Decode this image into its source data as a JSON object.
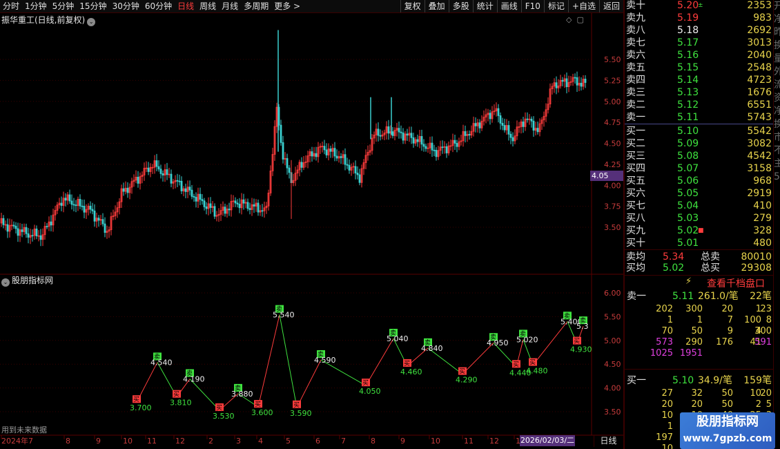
{
  "toolbar": {
    "periods": [
      "分时",
      "1分钟",
      "5分钟",
      "15分钟",
      "30分钟",
      "60分钟",
      "日线",
      "周线",
      "月线",
      "多周期",
      "更多 >"
    ],
    "active_period": "日线",
    "actions": [
      "复权",
      "叠加",
      "多股",
      "统计",
      "画线",
      "F10",
      "标记",
      "+自选",
      "返回"
    ]
  },
  "price_panel": {
    "title": "振华重工(日线,前复权)",
    "y_ticks": [
      "5.50",
      "5.25",
      "5.00",
      "4.75",
      "4.50",
      "4.25",
      "4.00",
      "3.75",
      "3.50"
    ],
    "current_price_tag": "4.05"
  },
  "indicator_panel": {
    "title": "股朋指标网",
    "y_ticks": [
      "6.00",
      "5.50",
      "5.00",
      "4.50",
      "4.00",
      "3.50"
    ],
    "footer_note": "用到未来数据",
    "buy_label": "买",
    "sell_label": "卖",
    "points": [
      {
        "type": "buy",
        "value": "3.700",
        "i": 0
      },
      {
        "type": "sell",
        "value": "4.540",
        "i": 1
      },
      {
        "type": "buy",
        "value": "3.810",
        "i": 2
      },
      {
        "type": "sell",
        "value": "4.190",
        "i": 3
      },
      {
        "type": "buy",
        "value": "3.530",
        "i": 4
      },
      {
        "type": "sell",
        "value": "3.880",
        "i": 5
      },
      {
        "type": "buy",
        "value": "3.600",
        "i": 6
      },
      {
        "type": "sell",
        "value": "5.540",
        "i": 7
      },
      {
        "type": "buy",
        "value": "3.590",
        "i": 8
      },
      {
        "type": "sell",
        "value": "4.590",
        "i": 9
      },
      {
        "type": "buy",
        "value": "4.050",
        "i": 10
      },
      {
        "type": "sell",
        "value": "5.040",
        "i": 11
      },
      {
        "type": "buy",
        "value": "4.460",
        "i": 12
      },
      {
        "type": "sell",
        "value": "4.840",
        "i": 13
      },
      {
        "type": "buy",
        "value": "4.290",
        "i": 14
      },
      {
        "type": "sell",
        "value": "4.950",
        "i": 15
      },
      {
        "type": "buy",
        "value": "4.440",
        "i": 16
      },
      {
        "type": "sell",
        "value": "5.020",
        "i": 17
      },
      {
        "type": "buy",
        "value": "4.480",
        "i": 18
      },
      {
        "type": "sell",
        "value": "5.400",
        "i": 19
      },
      {
        "type": "buy",
        "value": "4.930",
        "i": 20
      },
      {
        "type": "sell",
        "value": "5.3",
        "i": 21
      }
    ]
  },
  "time_axis": {
    "labels": [
      "2024年7",
      "8",
      "9",
      "10",
      "11",
      "12",
      "2",
      "3",
      "4",
      "5",
      "6",
      "7",
      "8",
      "9",
      "10",
      "11",
      "12",
      "1"
    ],
    "date_label": "2026/02/03/二",
    "period_button": "日线"
  },
  "order_book": {
    "asks": [
      {
        "label": "卖十",
        "price": "5.20",
        "vol": "2353",
        "pc": "r",
        "mark": "±",
        "mc": "g"
      },
      {
        "label": "卖九",
        "price": "5.19",
        "vol": "983",
        "pc": "r"
      },
      {
        "label": "卖八",
        "price": "5.18",
        "vol": "2692",
        "pc": "w"
      },
      {
        "label": "卖七",
        "price": "5.17",
        "vol": "3013",
        "pc": "g"
      },
      {
        "label": "卖六",
        "price": "5.16",
        "vol": "2040",
        "pc": "g"
      },
      {
        "label": "卖五",
        "price": "5.15",
        "vol": "2548",
        "pc": "g"
      },
      {
        "label": "卖四",
        "price": "5.14",
        "vol": "4723",
        "pc": "g"
      },
      {
        "label": "卖三",
        "price": "5.13",
        "vol": "1676",
        "pc": "g"
      },
      {
        "label": "卖二",
        "price": "5.12",
        "vol": "6551",
        "pc": "g"
      },
      {
        "label": "卖一",
        "price": "5.11",
        "vol": "5743",
        "pc": "g"
      }
    ],
    "bids": [
      {
        "label": "买一",
        "price": "5.10",
        "vol": "5542",
        "pc": "g"
      },
      {
        "label": "买二",
        "price": "5.09",
        "vol": "3082",
        "pc": "g"
      },
      {
        "label": "买三",
        "price": "5.08",
        "vol": "4542",
        "pc": "g"
      },
      {
        "label": "买四",
        "price": "5.07",
        "vol": "3158",
        "pc": "g"
      },
      {
        "label": "买五",
        "price": "5.06",
        "vol": "968",
        "pc": "g"
      },
      {
        "label": "买六",
        "price": "5.05",
        "vol": "2919",
        "pc": "g"
      },
      {
        "label": "买七",
        "price": "5.04",
        "vol": "410",
        "pc": "g"
      },
      {
        "label": "买八",
        "price": "5.03",
        "vol": "279",
        "pc": "g"
      },
      {
        "label": "买九",
        "price": "5.02",
        "vol": "328",
        "pc": "g",
        "mark": "■",
        "mc": "r"
      },
      {
        "label": "买十",
        "price": "5.01",
        "vol": "480",
        "pc": "g"
      }
    ],
    "avg_sell": {
      "label": "卖均",
      "price": "5.34",
      "total_label": "总卖",
      "total": "80010"
    },
    "avg_buy": {
      "label": "买均",
      "price": "5.02",
      "total_label": "总买",
      "total": "29308"
    },
    "depth_button": "查看千档盘口"
  },
  "queue": {
    "ask1": {
      "label": "卖一",
      "price": "5.11",
      "vol": "261.0/笔",
      "count": "22笔"
    },
    "ask_rows": [
      [
        "202",
        "300",
        "20",
        "1",
        "23"
      ],
      [
        "1",
        "1",
        "7",
        "100",
        "8"
      ],
      [
        "70",
        "50",
        "9",
        "4",
        "300"
      ],
      [
        "573",
        "290",
        "176",
        "41",
        "591"
      ],
      [
        "1025",
        "1951",
        "",
        "",
        ""
      ]
    ],
    "bid1": {
      "label": "买一",
      "price": "5.10",
      "vol": "34.9/笔",
      "count": "159笔"
    },
    "bid_rows": [
      [
        "27",
        "32",
        "50",
        "10",
        "20"
      ],
      [
        "20",
        "20",
        "50",
        "2",
        "5"
      ],
      [
        "10",
        "10",
        "40",
        "25",
        "3"
      ],
      [
        "1",
        "50",
        "",
        "",
        ""
      ],
      [
        "197",
        "",
        "",
        "",
        ""
      ],
      [
        "10",
        "20",
        "",
        "",
        ""
      ]
    ]
  },
  "side_edge": [
    "开",
    "净",
    "昨",
    "换",
    "量",
    "外",
    "流",
    "资",
    "净",
    "换",
    "市",
    "不",
    "主",
    "5"
  ],
  "watermark": {
    "name": "股朋指标网",
    "url": "www.7gpzb.com"
  },
  "colors": {
    "up": "#ff3c3c",
    "down": "#3fe33f",
    "bg": "#000000",
    "accent": "#55307a"
  }
}
